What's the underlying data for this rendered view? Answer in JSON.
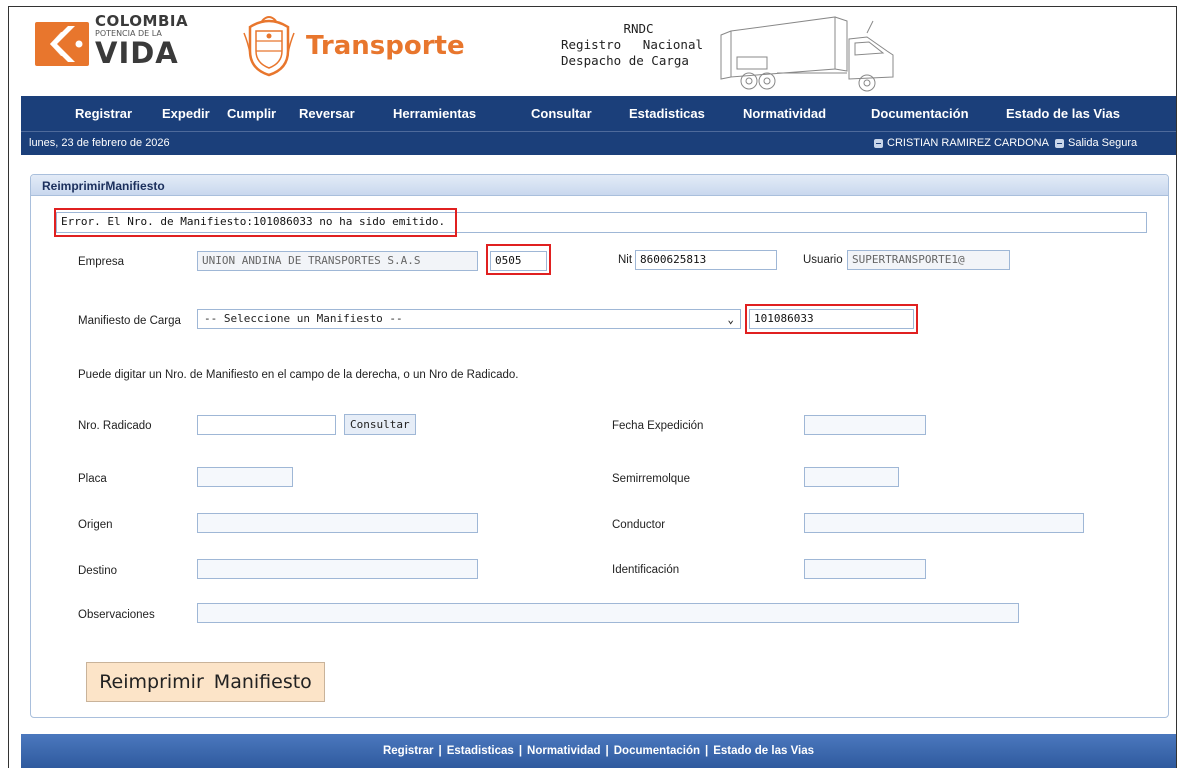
{
  "header": {
    "logo_line1": "COLOMBIA",
    "logo_line2": "POTENCIA DE LA",
    "logo_line3": "VIDA",
    "title": "Transporte",
    "rndc_line1": "RNDC",
    "rndc_line2": "Registro Nacional",
    "rndc_line3": "Despacho de Carga"
  },
  "nav": {
    "items": [
      "Registrar",
      "Expedir",
      "Cumplir",
      "Reversar",
      "Herramientas",
      "Consultar",
      "Estadisticas",
      "Normatividad",
      "Documentación",
      "Estado de las Vias"
    ]
  },
  "subbar": {
    "date": "lunes, 23 de febrero de 2026",
    "user": "CRISTIAN RAMIREZ CARDONA",
    "logout": "Salida Segura"
  },
  "panel": {
    "title": "ReimprimirManifiesto",
    "error_message": "Error. El Nro. de Manifiesto:101086033 no ha sido emitido.",
    "empresa_label": "Empresa",
    "empresa_value": "UNION ANDINA DE TRANSPORTES S.A.S",
    "empresa_code": "0505",
    "nit_label": "Nit",
    "nit_value": "8600625813",
    "usuario_label": "Usuario",
    "usuario_value": "SUPERTRANSPORTE1@",
    "manifiesto_label": "Manifiesto de Carga",
    "manifiesto_select": "-- Seleccione un Manifiesto --",
    "manifiesto_number": "101086033",
    "hint": "Puede digitar un Nro. de Manifiesto en el campo de la derecha, o un Nro de Radicado.",
    "radicado_label": "Nro. Radicado",
    "consultar_label": "Consultar",
    "fecha_label": "Fecha Expedición",
    "placa_label": "Placa",
    "semirremolque_label": "Semirremolque",
    "origen_label": "Origen",
    "conductor_label": "Conductor",
    "destino_label": "Destino",
    "identificacion_label": "Identificación",
    "observaciones_label": "Observaciones",
    "reimprimir_label": "Reimprimir Manifiesto"
  },
  "footer": {
    "links": [
      "Registrar",
      "Estadisticas",
      "Normatividad",
      "Documentación",
      "Estado de las Vias"
    ]
  },
  "colors": {
    "nav_bg": "#1b3f7a",
    "accent_orange": "#e8762d",
    "error_border": "#e02020",
    "button_bg": "#fce4c8"
  }
}
